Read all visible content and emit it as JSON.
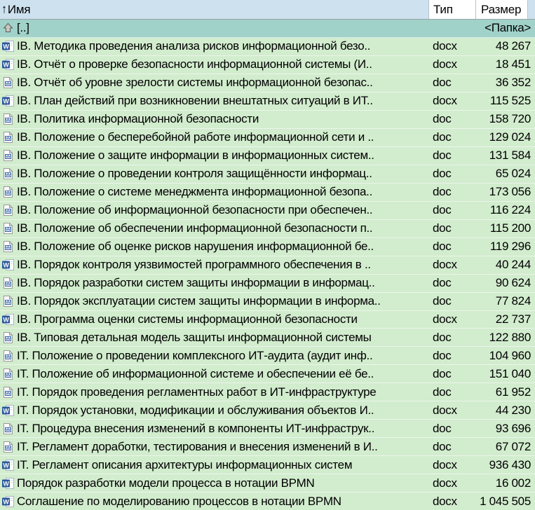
{
  "columns": {
    "name": "Имя",
    "type": "Тип",
    "size": "Размер",
    "sort_icon": "↑"
  },
  "parent": {
    "name": "[..]",
    "size": "<Папка>",
    "icon": "folder-up"
  },
  "files": [
    {
      "icon": "word-docx",
      "name": "IB. Методика проведения анализа рисков информационной безо..",
      "type": "docx",
      "size": "48 267"
    },
    {
      "icon": "word-docx",
      "name": "IB. Отчёт о проверке безопасности информационной системы (И..",
      "type": "docx",
      "size": "18 451"
    },
    {
      "icon": "word-doc",
      "name": "IB. Отчёт об уровне зрелости системы информационной безопас..",
      "type": "doc",
      "size": "36 352"
    },
    {
      "icon": "word-docx",
      "name": "IB. План действий при возникновении внештатных ситуаций в ИТ..",
      "type": "docx",
      "size": "115 525"
    },
    {
      "icon": "word-doc",
      "name": "IB. Политика информационной безопасности",
      "type": "doc",
      "size": "158 720"
    },
    {
      "icon": "word-doc",
      "name": "IB. Положение о бесперебойной работе информационной сети и ..",
      "type": "doc",
      "size": "129 024"
    },
    {
      "icon": "word-doc",
      "name": "IB. Положение о защите информации в информационных систем..",
      "type": "doc",
      "size": "131 584"
    },
    {
      "icon": "word-doc",
      "name": "IB. Положение о проведении контроля защищённости информац..",
      "type": "doc",
      "size": "65 024"
    },
    {
      "icon": "word-doc",
      "name": "IB. Положение о системе менеджмента информационной безопа..",
      "type": "doc",
      "size": "173 056"
    },
    {
      "icon": "word-doc",
      "name": "IB. Положение об информационной безопасности при обеспечен..",
      "type": "doc",
      "size": "116 224"
    },
    {
      "icon": "word-doc",
      "name": "IB. Положение об обеспечении информационной безопасности п..",
      "type": "doc",
      "size": "115 200"
    },
    {
      "icon": "word-doc",
      "name": "IB. Положение об оценке рисков нарушения информационной бе..",
      "type": "doc",
      "size": "119 296"
    },
    {
      "icon": "word-docx",
      "name": "IB. Порядок контроля уязвимостей программного обеспечения в ..",
      "type": "docx",
      "size": "40 244"
    },
    {
      "icon": "word-doc",
      "name": "IB. Порядок разработки систем защиты информации в информац..",
      "type": "doc",
      "size": "90 624"
    },
    {
      "icon": "word-doc",
      "name": "IB. Порядок эксплуатации систем защиты информации в информа..",
      "type": "doc",
      "size": "77 824"
    },
    {
      "icon": "word-docx",
      "name": "IB. Программа оценки системы информационной безопасности",
      "type": "docx",
      "size": "22 737"
    },
    {
      "icon": "word-doc",
      "name": "IB. Типовая детальная модель защиты информационной системы",
      "type": "doc",
      "size": "122 880"
    },
    {
      "icon": "word-doc",
      "name": "IT. Положение о проведении комплексного ИТ-аудита (аудит инф..",
      "type": "doc",
      "size": "104 960"
    },
    {
      "icon": "word-doc",
      "name": "IT. Положение об информационной системе и обеспечении её бе..",
      "type": "doc",
      "size": "151 040"
    },
    {
      "icon": "word-doc",
      "name": "IT. Порядок проведения регламентных работ в ИТ-инфраструктуре",
      "type": "doc",
      "size": "61 952"
    },
    {
      "icon": "word-docx",
      "name": "IT. Порядок установки, модификации и обслуживания объектов И..",
      "type": "docx",
      "size": "44 230"
    },
    {
      "icon": "word-doc",
      "name": "IT. Процедура внесения изменений в компоненты ИТ-инфраструк..",
      "type": "doc",
      "size": "93 696"
    },
    {
      "icon": "word-doc",
      "name": "IT. Регламент доработки, тестирования и внесения изменений в И..",
      "type": "doc",
      "size": "67 072"
    },
    {
      "icon": "word-docx",
      "name": "IT. Регламент описания архитектуры информационных систем",
      "type": "docx",
      "size": "936 430"
    },
    {
      "icon": "word-docx",
      "name": "Порядок разработки модели процесса в нотации BPMN",
      "type": "docx",
      "size": "16 002"
    },
    {
      "icon": "word-docx",
      "name": "Соглашение по моделированию процессов в нотации BPMN",
      "type": "docx",
      "size": "1 045 505"
    }
  ],
  "colors": {
    "header_sorted_bg": "#cde1ef",
    "header_bg": "#ffffff",
    "parent_row_bg": "#a0d2c9",
    "file_row_bg": "#d2ecce",
    "text": "#000000"
  }
}
